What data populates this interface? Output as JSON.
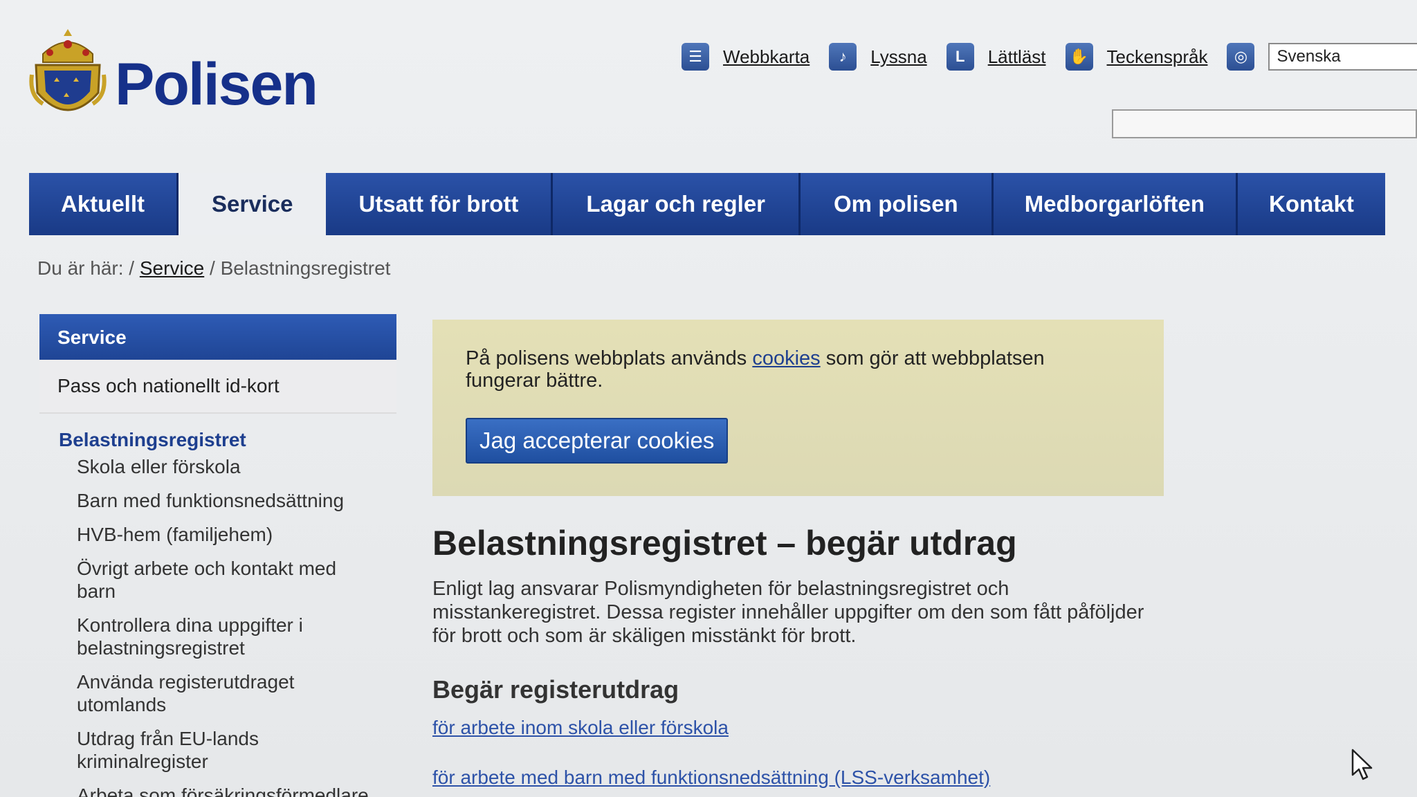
{
  "header": {
    "logo_text": "Polisen",
    "tools": [
      {
        "label": "Webbkarta",
        "icon": "sitemap-icon"
      },
      {
        "label": "Lyssna",
        "icon": "listen-icon"
      },
      {
        "label": "Lättläst",
        "icon": "easy-read-icon"
      },
      {
        "label": "Teckenspråk",
        "icon": "sign-language-icon"
      }
    ],
    "language_icon": "globe-icon",
    "language_value": "Svenska",
    "search_placeholder": ""
  },
  "nav": {
    "items": [
      {
        "label": "Aktuellt",
        "active": false
      },
      {
        "label": "Service",
        "active": true
      },
      {
        "label": "Utsatt för brott",
        "active": false
      },
      {
        "label": "Lagar och regler",
        "active": false
      },
      {
        "label": "Om polisen",
        "active": false
      },
      {
        "label": "Medborgarlöften",
        "active": false
      },
      {
        "label": "Kontakt",
        "active": false
      }
    ]
  },
  "breadcrumb": {
    "prefix": "Du är här: /",
    "link": "Service",
    "separator": " / ",
    "current": "Belastningsregistret"
  },
  "sidebar": {
    "header": "Service",
    "pass": "Pass och nationellt id-kort",
    "current": "Belastningsregistret",
    "subitems": [
      "Skola eller förskola",
      "Barn med funktionsnedsättning",
      "HVB-hem (familjehem)",
      "Övrigt arbete och kontakt med barn",
      "Kontrollera dina uppgifter i belastningsregistret",
      "Använda registerutdraget utomlands",
      "Utdrag från EU-lands kriminalregister",
      "Arbeta som försäkringsförmedlare"
    ]
  },
  "cookie": {
    "text_before": "På polisens webbplats används ",
    "link": "cookies",
    "text_after": " som gör att webbplatsen fungerar bättre.",
    "button": "Jag accepterar cookies"
  },
  "main": {
    "title": "Belastningsregistret – begär utdrag",
    "intro": "Enligt lag ansvarar Polismyndigheten för belastningsregistret och misstankeregistret. Dessa register innehåller uppgifter om den som fått påföljder för brott och som är skäligen misstänkt för brott.",
    "subhead": "Begär registerutdrag",
    "links": [
      "för arbete inom skola eller förskola",
      "för arbete med barn med funktionsnedsättning (LSS-verksamhet)"
    ]
  },
  "colors": {
    "brand_blue": "#16308a",
    "nav_blue": "#2b52a8",
    "cookie_bg": "#e4e0b6"
  }
}
